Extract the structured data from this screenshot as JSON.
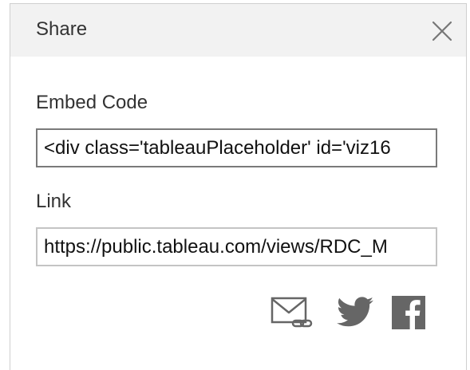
{
  "dialog": {
    "title": "Share",
    "close_icon": "close-icon"
  },
  "embed": {
    "label": "Embed Code",
    "value": "<div class='tableauPlaceholder' id='viz16"
  },
  "link": {
    "label": "Link",
    "value": "https://public.tableau.com/views/RDC_M"
  },
  "share_icons": [
    "email-link-icon",
    "twitter-icon",
    "facebook-icon"
  ],
  "colors": {
    "header_bg": "#f2f2f2",
    "icon_gray": "#666666",
    "text": "#333333"
  }
}
